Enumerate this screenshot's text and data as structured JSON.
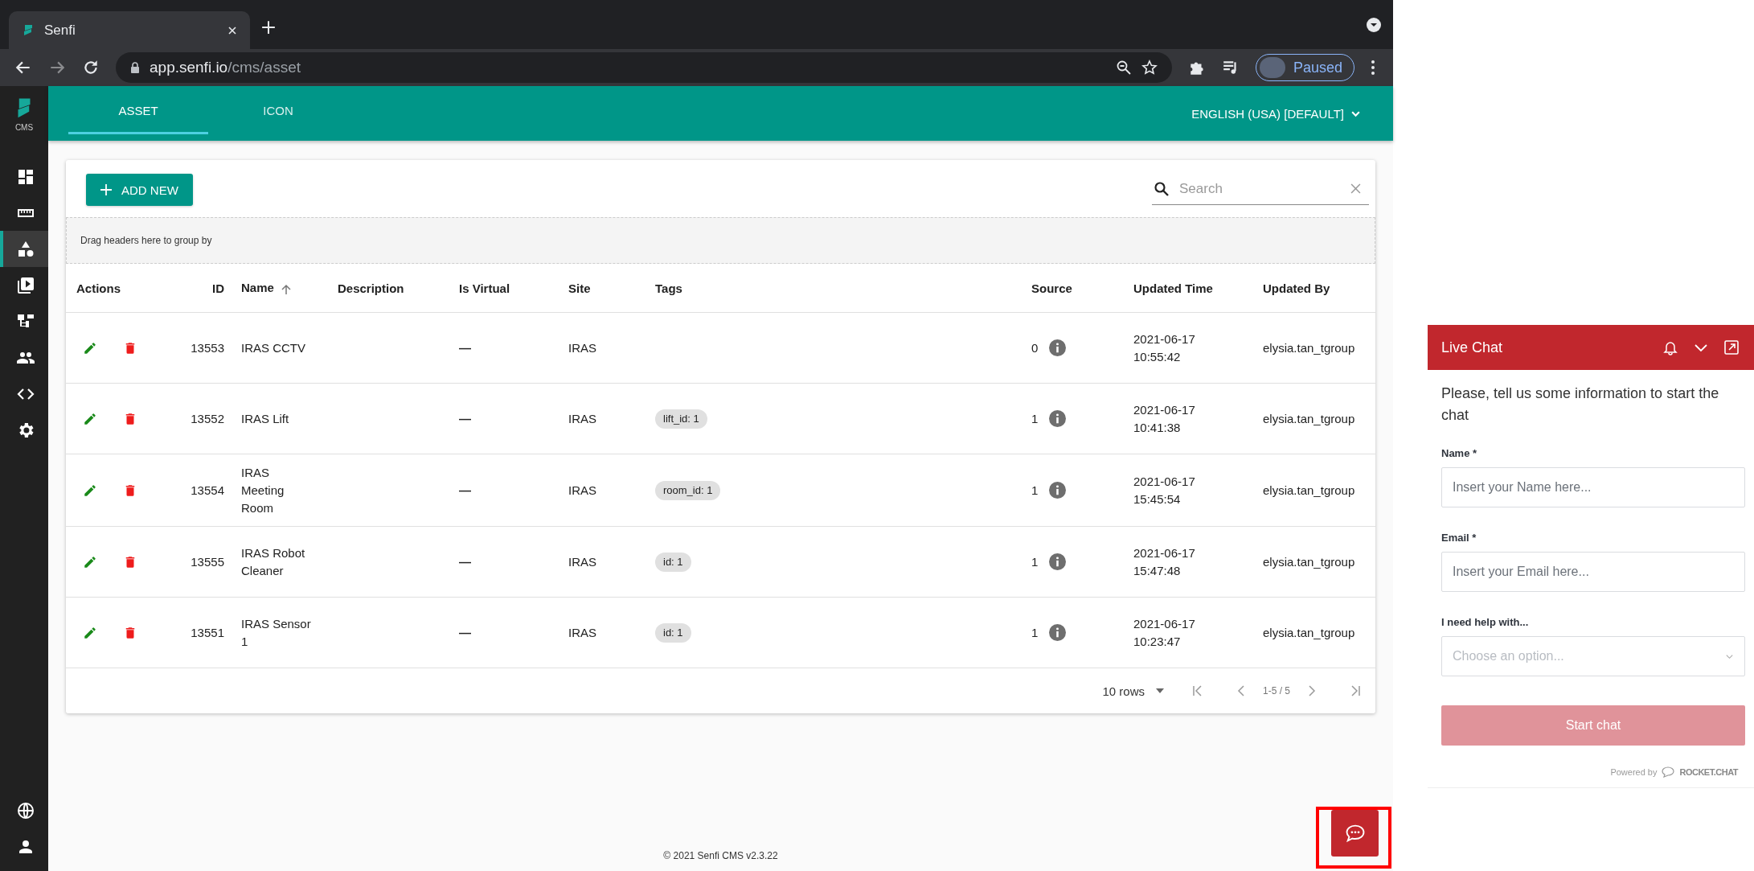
{
  "browser": {
    "tab_title": "Senfi",
    "url_host": "app.senfi.io",
    "url_path": "/cms/asset",
    "profile_label": "Paused"
  },
  "sidebar": {
    "logo_label": "CMS",
    "items": [
      {
        "kind": "dashboard",
        "selected": false
      },
      {
        "kind": "ruler",
        "selected": false
      },
      {
        "kind": "shapes",
        "selected": true
      },
      {
        "kind": "media",
        "selected": false
      },
      {
        "kind": "hierarchy",
        "selected": false
      },
      {
        "kind": "users",
        "selected": false
      },
      {
        "kind": "code",
        "selected": false
      },
      {
        "kind": "settings",
        "selected": false
      }
    ],
    "bottom_items": [
      {
        "kind": "globe",
        "selected": false
      },
      {
        "kind": "user",
        "selected": false
      }
    ]
  },
  "header": {
    "tabs": [
      {
        "label": "ASSET",
        "selected": true
      },
      {
        "label": "ICON",
        "selected": false
      }
    ],
    "language": "ENGLISH (USA) [DEFAULT]"
  },
  "toolbar": {
    "add_button": "ADD NEW",
    "search": {
      "placeholder": "Search"
    }
  },
  "group_panel": "Drag headers here to group by",
  "table": {
    "columns": [
      {
        "label": "Actions",
        "sorted": false
      },
      {
        "label": "ID",
        "sorted": false
      },
      {
        "label": "Name",
        "sorted": true
      },
      {
        "label": "Description",
        "sorted": false
      },
      {
        "label": "Is Virtual",
        "sorted": false
      },
      {
        "label": "Site",
        "sorted": false
      },
      {
        "label": "Tags",
        "sorted": false
      },
      {
        "label": "Source",
        "sorted": false
      },
      {
        "label": "Updated Time",
        "sorted": false
      },
      {
        "label": "Updated By",
        "sorted": false
      }
    ],
    "rows": [
      {
        "id": "13553",
        "name": "IRAS CCTV",
        "is_virtual": "—",
        "site": "IRAS",
        "tags": [],
        "source": "0",
        "updated_date": "2021-06-17",
        "updated_clock": "10:55:42",
        "updated_by": "elysia.tan_tgroup"
      },
      {
        "id": "13552",
        "name": "IRAS Lift",
        "is_virtual": "—",
        "site": "IRAS",
        "tags": [
          "lift_id: 1"
        ],
        "source": "1",
        "updated_date": "2021-06-17",
        "updated_clock": "10:41:38",
        "updated_by": "elysia.tan_tgroup"
      },
      {
        "id": "13554",
        "name": "IRAS Meeting Room",
        "is_virtual": "—",
        "site": "IRAS",
        "tags": [
          "room_id: 1"
        ],
        "source": "1",
        "updated_date": "2021-06-17",
        "updated_clock": "15:45:54",
        "updated_by": "elysia.tan_tgroup"
      },
      {
        "id": "13555",
        "name": "IRAS Robot Cleaner",
        "is_virtual": "—",
        "site": "IRAS",
        "tags": [
          "id: 1"
        ],
        "source": "1",
        "updated_date": "2021-06-17",
        "updated_clock": "15:47:48",
        "updated_by": "elysia.tan_tgroup"
      },
      {
        "id": "13551",
        "name": "IRAS Sensor 1",
        "is_virtual": "—",
        "site": "IRAS",
        "tags": [
          "id: 1"
        ],
        "source": "1",
        "updated_date": "2021-06-17",
        "updated_clock": "10:23:47",
        "updated_by": "elysia.tan_tgroup"
      }
    ]
  },
  "pagination": {
    "rows_per_page": "10 rows",
    "range": "1-5 / 5"
  },
  "footer": "© 2021 Senfi CMS v2.3.22",
  "chat": {
    "title": "Live Chat",
    "intro": "Please, tell us some information to start the chat",
    "fields": [
      {
        "kind": "text",
        "label": "Name *",
        "placeholder": "Insert your Name here..."
      },
      {
        "kind": "text",
        "label": "Email *",
        "placeholder": "Insert your Email here..."
      },
      {
        "kind": "select",
        "label": "I need help with...",
        "placeholder": "Choose an option..."
      }
    ],
    "submit": {
      "label": "Start chat",
      "disabled": true
    },
    "powered_by": "Powered by",
    "brand": "ROCKET.CHAT"
  }
}
